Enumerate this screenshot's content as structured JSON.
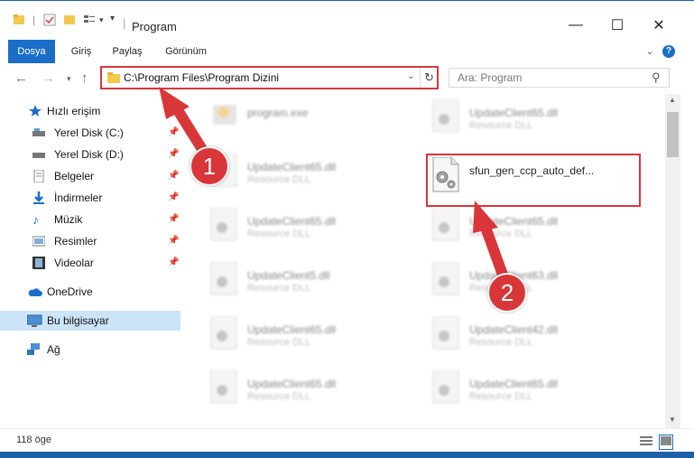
{
  "window": {
    "title": "Program",
    "controls": {
      "minimize": "—",
      "maximize": "☐",
      "close": "✕"
    }
  },
  "ribbon": {
    "tabs": [
      "Dosya",
      "Giriş",
      "Paylaş",
      "Görünüm"
    ],
    "collapse": "⌄",
    "help": "?"
  },
  "address": {
    "path": "C:\\Program Files\\Program Dizini"
  },
  "search": {
    "placeholder": "Ara: Program"
  },
  "sidebar": {
    "items": [
      {
        "label": "Hızlı erişim"
      },
      {
        "label": "Yerel Disk (C:)"
      },
      {
        "label": "Yerel Disk (D:)"
      },
      {
        "label": "Belgeler"
      },
      {
        "label": "İndirmeler"
      },
      {
        "label": "Müzik"
      },
      {
        "label": "Resimler"
      },
      {
        "label": "Videolar"
      },
      {
        "label": "OneDrive"
      },
      {
        "label": "Bu bilgisayar"
      },
      {
        "label": "Ağ"
      }
    ]
  },
  "files": {
    "left": [
      {
        "name": "program.exe",
        "type": ""
      },
      {
        "name": "UpdateClient65.dll",
        "type": "Resource DLL"
      },
      {
        "name": "UpdateClient65.dll",
        "type": "Resource DLL"
      },
      {
        "name": "UpdateClient5.dll",
        "type": "Resource DLL"
      },
      {
        "name": "UpdateClient65.dll",
        "type": "Resource DLL"
      },
      {
        "name": "UpdateClient65.dll",
        "type": "Resource DLL"
      }
    ],
    "right": [
      {
        "name": "UpdateClient65.dll",
        "type": "Resource DLL"
      },
      {
        "name": "sfun_gen_ccp_auto_def...",
        "type": ""
      },
      {
        "name": "UpdateClient65.dll",
        "type": "Resource DLL"
      },
      {
        "name": "UpdateClient63.dll",
        "type": "Resource DLL"
      },
      {
        "name": "UpdateClient42.dll",
        "type": "Resource DLL"
      },
      {
        "name": "UpdateClient65.dll",
        "type": "Resource DLL"
      }
    ]
  },
  "status": {
    "count": "118 öge"
  },
  "annotations": {
    "badge1": "1",
    "badge2": "2"
  },
  "colors": {
    "accent": "#1a6ec7",
    "highlight": "#d9363a"
  }
}
